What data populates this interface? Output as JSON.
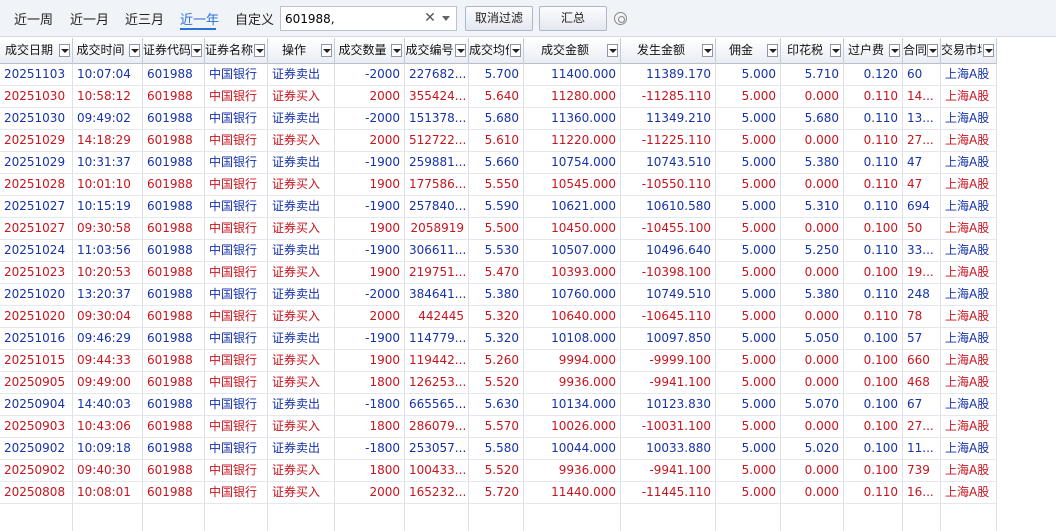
{
  "toolbar": {
    "periods": [
      "近一周",
      "近一月",
      "近三月",
      "近一年",
      "自定义"
    ],
    "active_period": "近一年",
    "filter": {
      "value": "601988,",
      "placeholder": ""
    },
    "cancel_filter_label": "取消过滤",
    "summary_label": "汇总"
  },
  "columns": [
    "成交日期",
    "成交时间",
    "证券代码",
    "证券名称",
    "操作",
    "成交数量",
    "成交编号",
    "成交均价",
    "成交金额",
    "发生金额",
    "佣金",
    "印花税",
    "过户费",
    "合同编号",
    "交易市场"
  ],
  "rows": [
    {
      "side": "sell",
      "cells": [
        "20251103",
        "10:07:04",
        "601988",
        "中国银行",
        "证券卖出",
        "-2000",
        "227682...",
        "5.700",
        "11400.000",
        "11389.170",
        "5.000",
        "5.710",
        "0.120",
        "60",
        "上海A股"
      ]
    },
    {
      "side": "buy",
      "cells": [
        "20251030",
        "10:58:12",
        "601988",
        "中国银行",
        "证券买入",
        "2000",
        "355424...",
        "5.640",
        "11280.000",
        "-11285.110",
        "5.000",
        "0.000",
        "0.110",
        "14...",
        "上海A股"
      ]
    },
    {
      "side": "sell",
      "cells": [
        "20251030",
        "09:49:02",
        "601988",
        "中国银行",
        "证券卖出",
        "-2000",
        "151378...",
        "5.680",
        "11360.000",
        "11349.210",
        "5.000",
        "5.680",
        "0.110",
        "13...",
        "上海A股"
      ]
    },
    {
      "side": "buy",
      "cells": [
        "20251029",
        "14:18:29",
        "601988",
        "中国银行",
        "证券买入",
        "2000",
        "512722...",
        "5.610",
        "11220.000",
        "-11225.110",
        "5.000",
        "0.000",
        "0.110",
        "27...",
        "上海A股"
      ]
    },
    {
      "side": "sell",
      "cells": [
        "20251029",
        "10:31:37",
        "601988",
        "中国银行",
        "证券卖出",
        "-1900",
        "259881...",
        "5.660",
        "10754.000",
        "10743.510",
        "5.000",
        "5.380",
        "0.110",
        "47",
        "上海A股"
      ]
    },
    {
      "side": "buy",
      "cells": [
        "20251028",
        "10:01:10",
        "601988",
        "中国银行",
        "证券买入",
        "1900",
        "177586...",
        "5.550",
        "10545.000",
        "-10550.110",
        "5.000",
        "0.000",
        "0.110",
        "47",
        "上海A股"
      ]
    },
    {
      "side": "sell",
      "cells": [
        "20251027",
        "10:15:19",
        "601988",
        "中国银行",
        "证券卖出",
        "-1900",
        "257840...",
        "5.590",
        "10621.000",
        "10610.580",
        "5.000",
        "5.310",
        "0.110",
        "694",
        "上海A股"
      ]
    },
    {
      "side": "buy",
      "cells": [
        "20251027",
        "09:30:58",
        "601988",
        "中国银行",
        "证券买入",
        "1900",
        "2058919",
        "5.500",
        "10450.000",
        "-10455.100",
        "5.000",
        "0.000",
        "0.100",
        "50",
        "上海A股"
      ]
    },
    {
      "side": "sell",
      "cells": [
        "20251024",
        "11:03:56",
        "601988",
        "中国银行",
        "证券卖出",
        "-1900",
        "306611...",
        "5.530",
        "10507.000",
        "10496.640",
        "5.000",
        "5.250",
        "0.110",
        "33...",
        "上海A股"
      ]
    },
    {
      "side": "buy",
      "cells": [
        "20251023",
        "10:20:53",
        "601988",
        "中国银行",
        "证券买入",
        "1900",
        "219751...",
        "5.470",
        "10393.000",
        "-10398.100",
        "5.000",
        "0.000",
        "0.100",
        "19...",
        "上海A股"
      ]
    },
    {
      "side": "sell",
      "cells": [
        "20251020",
        "13:20:37",
        "601988",
        "中国银行",
        "证券卖出",
        "-2000",
        "384641...",
        "5.380",
        "10760.000",
        "10749.510",
        "5.000",
        "5.380",
        "0.110",
        "248",
        "上海A股"
      ]
    },
    {
      "side": "buy",
      "cells": [
        "20251020",
        "09:30:04",
        "601988",
        "中国银行",
        "证券买入",
        "2000",
        "442445",
        "5.320",
        "10640.000",
        "-10645.110",
        "5.000",
        "0.000",
        "0.110",
        "78",
        "上海A股"
      ]
    },
    {
      "side": "sell",
      "cells": [
        "20251016",
        "09:46:29",
        "601988",
        "中国银行",
        "证券卖出",
        "-1900",
        "114779...",
        "5.320",
        "10108.000",
        "10097.850",
        "5.000",
        "5.050",
        "0.100",
        "57",
        "上海A股"
      ]
    },
    {
      "side": "buy",
      "cells": [
        "20251015",
        "09:44:33",
        "601988",
        "中国银行",
        "证券买入",
        "1900",
        "119442...",
        "5.260",
        "9994.000",
        "-9999.100",
        "5.000",
        "0.000",
        "0.100",
        "660",
        "上海A股"
      ]
    },
    {
      "side": "buy",
      "cells": [
        "20250905",
        "09:49:00",
        "601988",
        "中国银行",
        "证券买入",
        "1800",
        "126253...",
        "5.520",
        "9936.000",
        "-9941.100",
        "5.000",
        "0.000",
        "0.100",
        "468",
        "上海A股"
      ]
    },
    {
      "side": "sell",
      "cells": [
        "20250904",
        "14:40:03",
        "601988",
        "中国银行",
        "证券卖出",
        "-1800",
        "665565...",
        "5.630",
        "10134.000",
        "10123.830",
        "5.000",
        "5.070",
        "0.100",
        "67",
        "上海A股"
      ]
    },
    {
      "side": "buy",
      "cells": [
        "20250903",
        "10:43:06",
        "601988",
        "中国银行",
        "证券买入",
        "1800",
        "286079...",
        "5.570",
        "10026.000",
        "-10031.100",
        "5.000",
        "0.000",
        "0.100",
        "27...",
        "上海A股"
      ]
    },
    {
      "side": "sell",
      "cells": [
        "20250902",
        "10:09:18",
        "601988",
        "中国银行",
        "证券卖出",
        "-1800",
        "253057...",
        "5.580",
        "10044.000",
        "10033.880",
        "5.000",
        "5.020",
        "0.100",
        "11...",
        "上海A股"
      ]
    },
    {
      "side": "buy",
      "cells": [
        "20250902",
        "09:40:30",
        "601988",
        "中国银行",
        "证券买入",
        "1800",
        "100433...",
        "5.520",
        "9936.000",
        "-9941.100",
        "5.000",
        "0.000",
        "0.100",
        "739",
        "上海A股"
      ]
    },
    {
      "side": "buy",
      "cells": [
        "20250808",
        "10:08:01",
        "601988",
        "中国银行",
        "证券买入",
        "2000",
        "165232...",
        "5.720",
        "11440.000",
        "-11445.110",
        "5.000",
        "0.000",
        "0.110",
        "16...",
        "上海A股"
      ]
    }
  ],
  "colors": {
    "buy": "#c8141e",
    "sell": "#1632a8",
    "accent": "#2a72d6"
  }
}
